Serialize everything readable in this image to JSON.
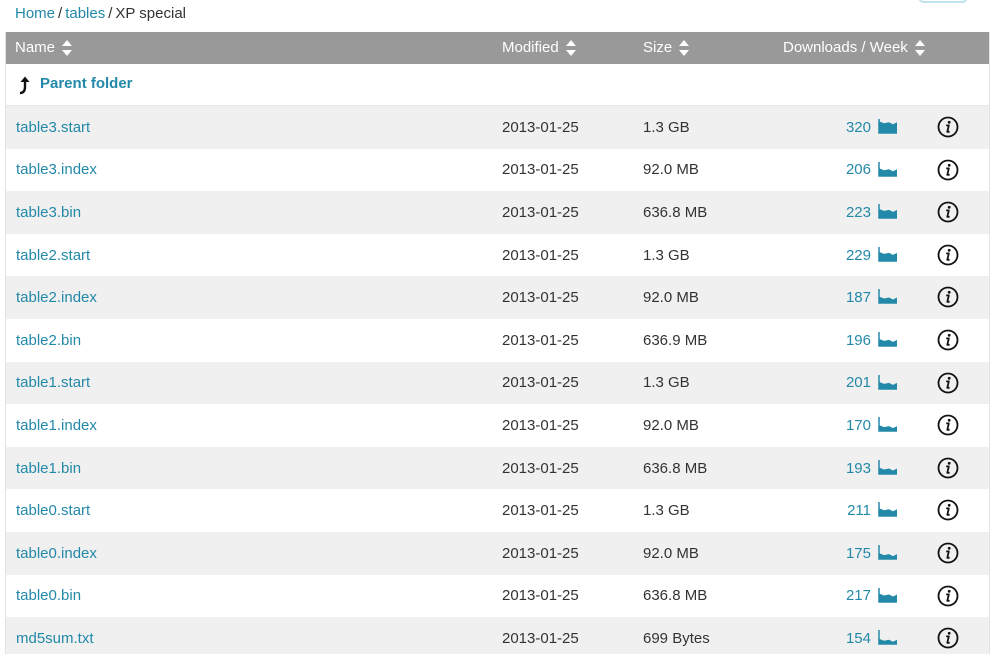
{
  "breadcrumb": {
    "home": "Home",
    "sep1": "/",
    "tables": "tables",
    "sep2": "/",
    "current": "XP special"
  },
  "header": {
    "name": "Name",
    "modified": "Modified",
    "size": "Size",
    "downloads": "Downloads / Week"
  },
  "parent": {
    "label": "Parent folder"
  },
  "files": [
    {
      "name": "table3.start",
      "modified": "2013-01-25",
      "size": "1.3 GB",
      "downloads": "320",
      "trend": 0.9
    },
    {
      "name": "table3.index",
      "modified": "2013-01-25",
      "size": "92.0 MB",
      "downloads": "206",
      "trend": 0.6
    },
    {
      "name": "table3.bin",
      "modified": "2013-01-25",
      "size": "636.8 MB",
      "downloads": "223",
      "trend": 0.7
    },
    {
      "name": "table2.start",
      "modified": "2013-01-25",
      "size": "1.3 GB",
      "downloads": "229",
      "trend": 0.7
    },
    {
      "name": "table2.index",
      "modified": "2013-01-25",
      "size": "92.0 MB",
      "downloads": "187",
      "trend": 0.5
    },
    {
      "name": "table2.bin",
      "modified": "2013-01-25",
      "size": "636.9 MB",
      "downloads": "196",
      "trend": 0.55
    },
    {
      "name": "table1.start",
      "modified": "2013-01-25",
      "size": "1.3 GB",
      "downloads": "201",
      "trend": 0.55
    },
    {
      "name": "table1.index",
      "modified": "2013-01-25",
      "size": "92.0 MB",
      "downloads": "170",
      "trend": 0.45
    },
    {
      "name": "table1.bin",
      "modified": "2013-01-25",
      "size": "636.8 MB",
      "downloads": "193",
      "trend": 0.5
    },
    {
      "name": "table0.start",
      "modified": "2013-01-25",
      "size": "1.3 GB",
      "downloads": "211",
      "trend": 0.6
    },
    {
      "name": "table0.index",
      "modified": "2013-01-25",
      "size": "92.0 MB",
      "downloads": "175",
      "trend": 0.45
    },
    {
      "name": "table0.bin",
      "modified": "2013-01-25",
      "size": "636.8 MB",
      "downloads": "217",
      "trend": 0.65
    },
    {
      "name": "md5sum.txt",
      "modified": "2013-01-25",
      "size": "699 Bytes",
      "downloads": "154",
      "trend": 0.4
    }
  ],
  "icons": {
    "sort": "sort-icon",
    "parent": "parent-folder-arrow-icon",
    "chart": "downloads-chart-icon",
    "info": "info-icon"
  },
  "colors": {
    "link": "#2389a8",
    "header_bg": "#999999",
    "row_alt": "#f0f0f0"
  }
}
